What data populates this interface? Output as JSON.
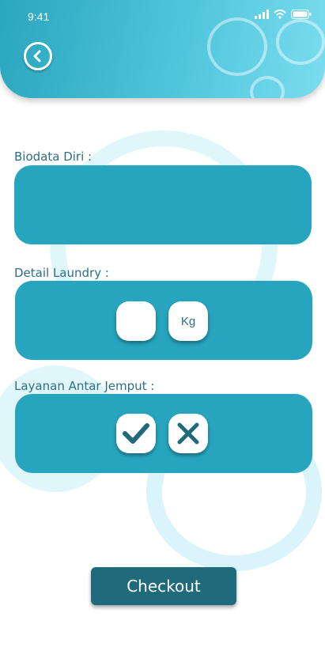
{
  "status_bar": {
    "time": "9:41"
  },
  "labels": {
    "biodata": "Biodata  Diri :",
    "detail": "Detail Laundry :",
    "layanan": "Layanan Antar Jemput :"
  },
  "weight_unit": "Kg",
  "checkout_label": "Checkout",
  "colors": {
    "primary": "#27a5bf",
    "dark": "#1f6b7b",
    "text": "#2d6f83"
  },
  "icons": {
    "back": "back-arrow-icon",
    "confirm": "check-icon",
    "cancel": "close-icon"
  }
}
